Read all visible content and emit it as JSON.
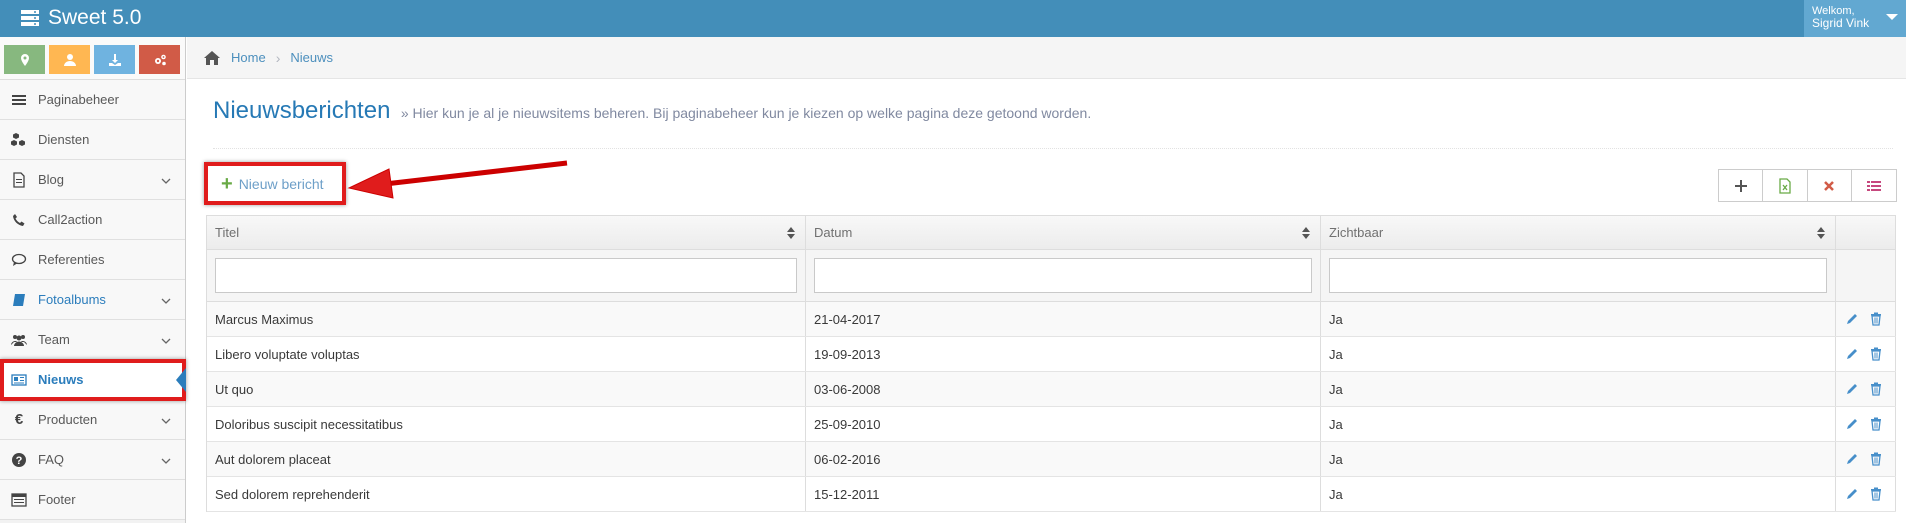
{
  "app": {
    "title": "Sweet 5.0"
  },
  "user": {
    "greeting": "Welkom,",
    "name": "Sigrid Vink"
  },
  "colors": {
    "topbar": "#438eb9",
    "accent": "#2b7dbc",
    "annotation_red": "#e01c1c",
    "shortcut_green": "#87b87f",
    "shortcut_orange": "#ffb752",
    "shortcut_blue": "#6fb3e0",
    "shortcut_red": "#d15b47"
  },
  "shortcuts": [
    {
      "icon": "map-marker-icon",
      "color": "#87b87f"
    },
    {
      "icon": "user-icon",
      "color": "#ffb752"
    },
    {
      "icon": "download-icon",
      "color": "#6fb3e0"
    },
    {
      "icon": "cogs-icon",
      "color": "#d15b47"
    }
  ],
  "sidebar": {
    "items": [
      {
        "label": "Paginabeheer",
        "icon": "bars-icon"
      },
      {
        "label": "Diensten",
        "icon": "cubes-icon"
      },
      {
        "label": "Blog",
        "icon": "file-icon"
      },
      {
        "label": "Call2action",
        "icon": "phone-icon"
      },
      {
        "label": "Referenties",
        "icon": "comment-icon"
      },
      {
        "label": "Fotoalbums",
        "icon": "book-icon"
      },
      {
        "label": "Team",
        "icon": "users-icon"
      },
      {
        "label": "Nieuws",
        "icon": "newspaper-icon"
      },
      {
        "label": "Producten",
        "icon": "euro-icon"
      },
      {
        "label": "FAQ",
        "icon": "question-icon"
      },
      {
        "label": "Footer",
        "icon": "list-alt-icon"
      }
    ]
  },
  "breadcrumb": {
    "home": "Home",
    "current": "Nieuws"
  },
  "page": {
    "title": "Nieuwsberichten",
    "subtitle": "» Hier kun je al je nieuwsitems beheren. Bij paginabeheer kun je kiezen op welke pagina deze getoond worden."
  },
  "new_button": {
    "label": "Nieuw bericht"
  },
  "table": {
    "columns": [
      "Titel",
      "Datum",
      "Zichtbaar"
    ],
    "rows": [
      {
        "title": "Marcus Maximus",
        "date": "21-04-2017",
        "visible": "Ja"
      },
      {
        "title": "Libero voluptate voluptas",
        "date": "19-09-2013",
        "visible": "Ja"
      },
      {
        "title": "Ut quo",
        "date": "03-06-2008",
        "visible": "Ja"
      },
      {
        "title": "Doloribus suscipit necessitatibus",
        "date": "25-09-2010",
        "visible": "Ja"
      },
      {
        "title": "Aut dolorem placeat",
        "date": "06-02-2016",
        "visible": "Ja"
      },
      {
        "title": "Sed dolorem reprehenderit",
        "date": "15-12-2011",
        "visible": "Ja"
      }
    ]
  }
}
